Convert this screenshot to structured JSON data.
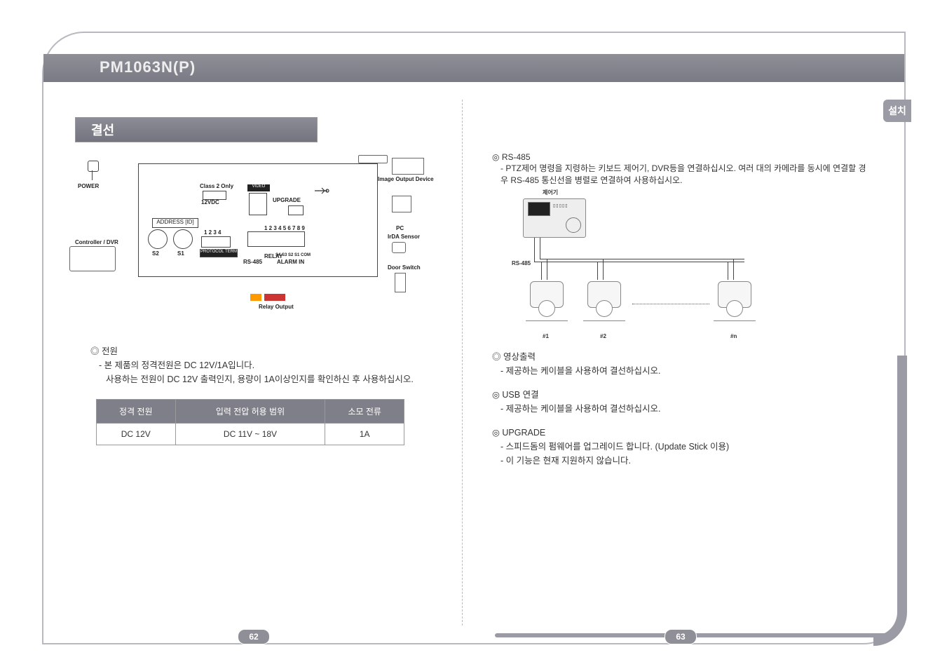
{
  "header": {
    "model": "PM1063N(P)"
  },
  "side_tab": {
    "label": "설치"
  },
  "left": {
    "section_title": "결선",
    "diagram": {
      "power": "POWER",
      "controller": "Controller / DVR",
      "class2": "Class 2 Only",
      "12vdc": "12VDC",
      "address": "ADDRESS [ID]",
      "s2": "S2",
      "s1": "S1",
      "protocol_term": "PROTOCOL TERM",
      "dip_nums": "1 2 3 4",
      "video": "VIDEO",
      "upgrade": "UPGRADE",
      "nums_9": "1 2 3 4 5 6 7 8 9",
      "rs485": "RS-485",
      "relay": "RELAY",
      "alarm": "ALARM IN",
      "alarm_pins": "S4 S3 S2 S1 COM",
      "img_output": "Image Output Device",
      "pc": "PC",
      "irda": "IrDA Sensor",
      "door_switch": "Door Switch",
      "relay_output": "Relay Output"
    },
    "power_section": {
      "title": "전원",
      "line1": "- 본 제품의 정격전원은 DC 12V/1A입니다.",
      "line2": "사용하는 전원이 DC 12V 출력인지, 용량이 1A이상인지를 확인하신 후 사용하십시오."
    },
    "table": {
      "h1": "정격 전원",
      "h2": "입력 전압 허용 범위",
      "h3": "소모 전류",
      "c1": "DC 12V",
      "c2": "DC 11V ~ 18V",
      "c3": "1A"
    },
    "page_number": "62"
  },
  "right": {
    "rs485": {
      "title": "RS-485",
      "desc": "- PTZ제어 명령을 지령하는 키보드 제어기, DVR등을 연결하십시오. 여러 대의 카메라를 동시에 연결할 경우 RS-485 통신선을 병렬로 연결하여 사용하십시오.",
      "controller_label": "제어기",
      "rs_label": "RS-485",
      "cam1": "#1",
      "cam2": "#2",
      "camn": "#n"
    },
    "video_out": {
      "title": "영상출력",
      "line1": "- 제공하는 케이블을 사용하여 결선하십시오."
    },
    "usb": {
      "title": "USB 연결",
      "line1": "- 제공하는 케이블을 사용하여 결선하십시오."
    },
    "upgrade": {
      "title": "UPGRADE",
      "line1": "- 스피드돔의 펌웨어를 업그레이드 합니다. (Update Stick 이용)",
      "line2": "- 이 기능은 현재 지원하지 않습니다."
    },
    "page_number": "63"
  }
}
